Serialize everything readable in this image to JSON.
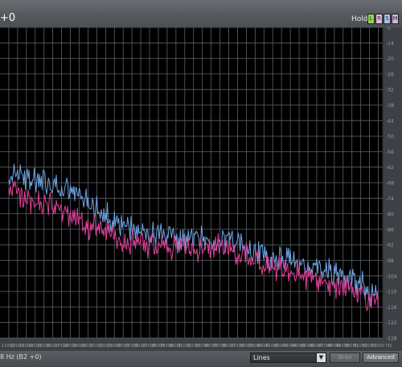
{
  "header": {
    "channel_label": "+0",
    "hold_label": "Hold",
    "hold_buttons": [
      {
        "label": "L",
        "color": "#8fd45a"
      },
      {
        "label": "R",
        "color": "#e7b7dc"
      },
      {
        "label": "S",
        "color": "#a9bfe6"
      },
      {
        "label": "M",
        "color": "#d7b0e6"
      }
    ]
  },
  "chart_data": {
    "type": "line",
    "title": "",
    "xlabel": "",
    "ylabel": "",
    "x_ticks": [
      "11000",
      "12000",
      "13000",
      "14000",
      "15000",
      "16000",
      "17000",
      "18000",
      "19000",
      "20000",
      "21000",
      "22000",
      "23000",
      "24000",
      "25000",
      "26000",
      "27000",
      "28000",
      "29000",
      "30000",
      "31000",
      "32000",
      "33000",
      "34000",
      "35000",
      "36000",
      "37000",
      "38000",
      "39000",
      "40000",
      "41000",
      "42000",
      "43000",
      "44000",
      "45000",
      "46000",
      "47000",
      "48000",
      "49000",
      "50000",
      "51000",
      "52000",
      "53000"
    ],
    "x_unit": "Hz",
    "y_ticks": [
      "-8",
      "-14",
      "-20",
      "-26",
      "-32",
      "-38",
      "-44",
      "-50",
      "-56",
      "-62",
      "-68",
      "-74",
      "-80",
      "-86",
      "-92",
      "-98",
      "-104",
      "-110",
      "-116",
      "-122",
      "-128"
    ],
    "ylim": [
      -128,
      -8
    ],
    "grid": true,
    "series": [
      {
        "color": "#6fa5e6",
        "x": [
          11000,
          12000,
          13000,
          14000,
          15000,
          16000,
          17000,
          18000,
          19000,
          20000,
          21000,
          22000,
          23000,
          24000,
          25000,
          26000,
          27000,
          28000,
          29000,
          30000,
          31000,
          32000,
          33000,
          34000,
          35000,
          36000,
          37000,
          38000,
          39000,
          40000,
          41000,
          42000,
          43000,
          44000,
          45000,
          46000,
          47000,
          48000,
          49000,
          50000,
          51000,
          52000,
          53000
        ],
        "values": [
          -65,
          -63,
          -66,
          -68,
          -67,
          -70,
          -72,
          -71,
          -73,
          -75,
          -77,
          -80,
          -84,
          -84,
          -86,
          -88,
          -88,
          -89,
          -89,
          -90,
          -91,
          -90,
          -90,
          -91,
          -89,
          -90,
          -92,
          -94,
          -95,
          -96,
          -97,
          -98,
          -98,
          -99,
          -100,
          -101,
          -102,
          -103,
          -104,
          -106,
          -107,
          -110,
          -111
        ]
      },
      {
        "color": "#e0409a",
        "x": [
          11000,
          12000,
          13000,
          14000,
          15000,
          16000,
          17000,
          18000,
          19000,
          20000,
          21000,
          22000,
          23000,
          24000,
          25000,
          26000,
          27000,
          28000,
          29000,
          30000,
          31000,
          32000,
          33000,
          34000,
          35000,
          36000,
          37000,
          38000,
          39000,
          40000,
          41000,
          42000,
          43000,
          44000,
          45000,
          46000,
          47000,
          48000,
          49000,
          50000,
          51000,
          52000,
          53000
        ],
        "values": [
          -70,
          -72,
          -74,
          -75,
          -76,
          -77,
          -78,
          -80,
          -82,
          -85,
          -85,
          -86,
          -88,
          -90,
          -91,
          -91,
          -92,
          -93,
          -93,
          -93,
          -94,
          -94,
          -94,
          -93,
          -92,
          -93,
          -95,
          -96,
          -98,
          -99,
          -100,
          -101,
          -102,
          -103,
          -104,
          -105,
          -106,
          -107,
          -108,
          -110,
          -111,
          -113,
          -115
        ]
      }
    ]
  },
  "status": {
    "text": "8 Hz (B2 +0)"
  },
  "controls": {
    "mode_value": "Lines",
    "scan_label": "Scan",
    "advanced_label": "Advanced"
  }
}
